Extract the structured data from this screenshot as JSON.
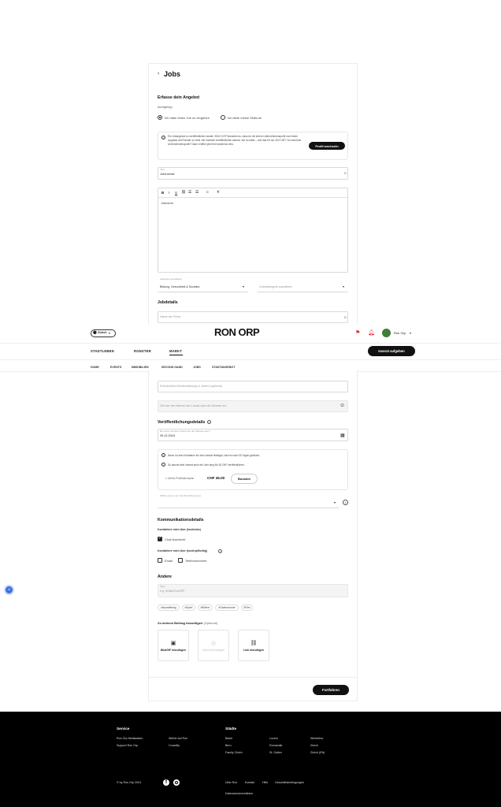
{
  "page": {
    "back_icon": "chevron-left-icon",
    "title": "Jobs",
    "section_title": "Erfasse dein Angebot",
    "ad_type_label": "Anzeigentyp",
    "radio_options": [
      "Ich habe einen Job zu vergeben",
      "Ich biete meine Skills an"
    ],
    "info_box": {
      "text": "Ein Jobangebot zu veröffentlichen kostet: 35.00 CHF Wusstest du, dass du mit einem Unternehmensprofil und einem Upgrade auf Ronster so viele Job Inserate veröffentlichen kannst, wie du willst – und das für nur 420 CHF? Du hast kein Unternehmensprofil? Dann eröffne jetzt hier kostenlos eins.",
      "button": "Profil wechseln"
    },
    "title_field": {
      "label": "Titel",
      "value": "Jobinserat"
    },
    "editor": {
      "toolbar": [
        "B",
        "I",
        "U",
        "link",
        "ul",
        "ol",
        "emoji",
        "clear"
      ],
      "value": "Jobinserat"
    },
    "category": {
      "label": "Kategorie auswählen",
      "value": "Bildung, Gesundheit & Soziales"
    },
    "subcategory": {
      "placeholder": "Unterkategorie auswählen"
    },
    "jobdetails_title": "Jobdetails",
    "company_field": {
      "placeholder": "Name der Firma"
    },
    "experience_field": {
      "placeholder": "Erforderliche Berufserfahrung in Jahren (optional)"
    },
    "location_field": {
      "placeholder": "Gib hier den Namen des Lokals oder die Adresse ein."
    },
    "publish_title": "Veröffentlichungsdetails",
    "publish_date": {
      "label": "Bis wann soll dein Inserat auf der Website sein?",
      "value": "29.12.2024"
    },
    "publish_info": [
      "Wenn du kein Enddatum für dein Inserat festlegst, wird es nach 30 Tagen gelöscht.",
      "Du kannst dein Inserat auch ein Jahr lang für 45 CHF veröffentlichen."
    ],
    "boost": {
      "label": "1 Jahres Publikationsplan",
      "price": "CHF 45.00",
      "button": "Boosten"
    },
    "visibility_field": {
      "label": "Wähle aus wo der Veröffentlichung aus"
    },
    "communication_title": "Kommunikationsdetails",
    "contact_label": "Kontaktiere mich über (kostenlos)",
    "contact_free": [
      "Chat Nachricht"
    ],
    "contact_paid_label": "Kontaktiere mich über (kostenpflichtig)",
    "contact_paid": [
      "Email",
      "Telefonnummer"
    ],
    "other_title": "Andere",
    "tags_field": {
      "label": "Tags",
      "placeholder": "e.g. #HalloRonORP"
    },
    "tags": [
      "#Ausstellung",
      "#Sport",
      "#Bühne",
      "#Gastronomie",
      "#Film"
    ],
    "attach_title": "Zu deinem Beitrag hinzufügen",
    "attach_optional": "(Optional)",
    "attachments": [
      {
        "icon": "image-icon",
        "label": "Bild/GIF hinzufügen"
      },
      {
        "icon": "video-icon",
        "label": "Video hinzufügen"
      },
      {
        "icon": "link-icon",
        "label": "Link hinzufügen"
      }
    ],
    "continue_button": "Fortfahren"
  },
  "header": {
    "city": "Zürich",
    "logo": "RON ORP",
    "user": "Ron Orp",
    "nav": [
      "STADTLEBEN",
      "RONSTER",
      "MARKT"
    ],
    "cta": "Inserat aufgeben",
    "subnav": [
      "HOME",
      "EVENTS",
      "IMMOBILIEN",
      "SECOND HAND",
      "JOBS",
      "STADTANGEBOT"
    ]
  },
  "footer": {
    "service_title": "Service",
    "service_links": [
      "Ron Orp Mediadaten",
      "Support Ron Orp",
      "Werbe auf Ron",
      "Crowdify"
    ],
    "cities_title": "Städte",
    "cities": [
      "Basel",
      "Bern",
      "Family Zürich",
      "Luzern",
      "Romandie",
      "St. Gallen",
      "Winterthur",
      "Zürich",
      "Zürich (EN)"
    ],
    "copyright": "© by Ron Orp 2024",
    "legal": [
      "Über Ron",
      "Kontakt",
      "Hilfe",
      "Geschäftsbedingungen",
      "Datenschutzrichtlinien"
    ]
  }
}
